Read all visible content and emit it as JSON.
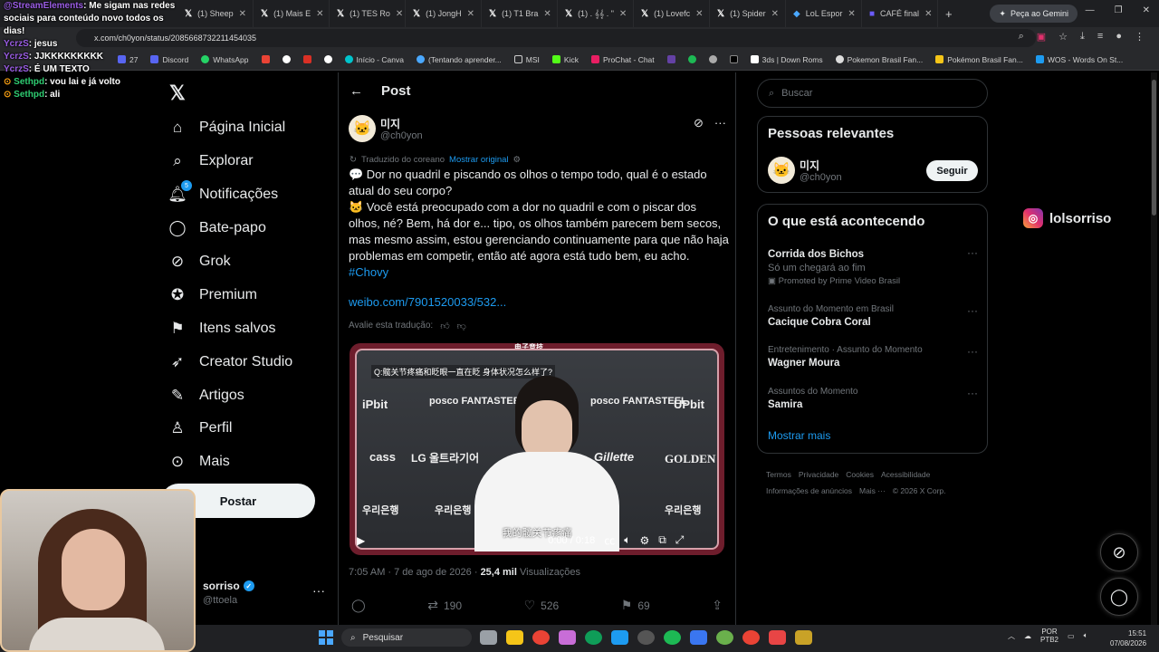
{
  "browser": {
    "tabs": [
      {
        "label": "(1) Sheep",
        "icon": "x-icon"
      },
      {
        "label": "(1) Mais E",
        "icon": "x-icon"
      },
      {
        "label": "(1) TES Ro",
        "icon": "x-icon"
      },
      {
        "label": "(1) JongH",
        "icon": "x-icon"
      },
      {
        "label": "(1) T1 Bra",
        "icon": "x-icon"
      },
      {
        "label": "(1) . 𝄞𝄞 . \"",
        "icon": "x-icon"
      },
      {
        "label": "(1) Lovefc",
        "icon": "x-icon"
      },
      {
        "label": "(1) Spider",
        "icon": "x-icon"
      },
      {
        "label": "LoL Espor",
        "icon": "lol-icon"
      },
      {
        "label": "CAFÉ final",
        "icon": "video-icon"
      }
    ],
    "new_tab": "+",
    "gemini_label": "Peça ao Gemini",
    "url": "x.com/ch0yon/status/2085668732211454035",
    "bookmarks": [
      "Discord",
      "WhatsApp",
      "Início - Canva",
      "(Tentando aprender...",
      "MSI",
      "Kick",
      "ProChat - Chat",
      "3ds | Down Roms",
      "Pokemon Brasil Fan...",
      "Pokémon Brasil Fan...",
      "WOS - Words On St..."
    ],
    "bookmark_badge": "27"
  },
  "chat": [
    {
      "nick": "@StreamElements",
      "text": "Me sigam nas redes sociais para conteúdo novo todos os dias!"
    },
    {
      "nick": "YcrzS",
      "text": "jesus"
    },
    {
      "nick": "YcrzS",
      "text": "JJKKKKKKKKK"
    },
    {
      "nick": "YcrzS",
      "text": "É UM TEXTO"
    },
    {
      "nick": "Sethpd",
      "text": "vou lai e já volto"
    },
    {
      "nick": "Sethpd",
      "text": "ali"
    }
  ],
  "nav": {
    "items": [
      "Página Inicial",
      "Explorar",
      "Notificações",
      "Bate-papo",
      "Grok",
      "Premium",
      "Itens salvos",
      "Creator Studio",
      "Artigos",
      "Perfil",
      "Mais"
    ],
    "notif_badge": "5",
    "post_button": "Postar",
    "account_name": "sorriso",
    "account_handle": "@ttoela"
  },
  "post": {
    "header": "Post",
    "author_name": "미지",
    "author_handle": "@ch0yon",
    "translated_from": "Traduzido do coreano",
    "show_original": "Mostrar original",
    "line1": "💬 Dor no quadril e piscando os olhos o tempo todo, qual é o estado atual do seu corpo?",
    "line2": "🐱 Você está preocupado com a dor no quadril e com o piscar dos olhos, né? Bem, há dor e... tipo, os olhos também parecem bem secos, mas mesmo assim, estou gerenciando continuamente para que não haja problemas em competir, então até agora está tudo bem, eu acho.",
    "hashtag": "#Chovy",
    "link": "weibo.com/7901520033/532...",
    "rate_translation": "Avalie esta tradução:",
    "video": {
      "brand": "电子竞技",
      "overlay_text": "Q:髋关节疼痛和眨眼一直在眨 身体状况怎么样了?",
      "subtitle": "我的髋关节疼痛",
      "time": "0:00 / 0:18",
      "sponsors": [
        "iPbit",
        "posco FANTASTEEL",
        "posco FANTASTEEL",
        "UPbit",
        "cass",
        "LG 울트라기어",
        "Gillette",
        "GOLDEN",
        "우리은행",
        "우리은행",
        "우리은행"
      ]
    },
    "timestamp": "7:05 AM · 7 de ago de 2026 ·",
    "views_count": "25,4 mil",
    "views_label": "Visualizações",
    "retweets": "190",
    "likes": "526",
    "bookmarks": "69"
  },
  "sidebar": {
    "search_placeholder": "Buscar",
    "relevant_title": "Pessoas relevantes",
    "relevant_name": "미지",
    "relevant_handle": "@ch0yon",
    "follow_label": "Seguir",
    "happening_title": "O que está acontecendo",
    "trends": [
      {
        "context": "",
        "name": "Corrida dos Bichos",
        "sub": "Só um chegará ao fim",
        "promo": "Promoted by Prime Video Brasil"
      },
      {
        "context": "Assunto do Momento em Brasil",
        "name": "Cacique Cobra Coral"
      },
      {
        "context": "Entretenimento · Assunto do Momento",
        "name": "Wagner Moura"
      },
      {
        "context": "Assuntos do Momento",
        "name": "Samira"
      }
    ],
    "show_more": "Mostrar mais",
    "footer": [
      "Termos",
      "Privacidade",
      "Cookies",
      "Acessibilidade",
      "Informações de anúncios",
      "Mais ···",
      "© 2026 X Corp."
    ]
  },
  "stream": {
    "instagram_handle": "lolsorriso"
  },
  "taskbar": {
    "search_label": "Pesquisar",
    "lang_line1": "POR",
    "lang_line2": "PTB2",
    "time": "15:51",
    "date": "07/08/2026"
  }
}
